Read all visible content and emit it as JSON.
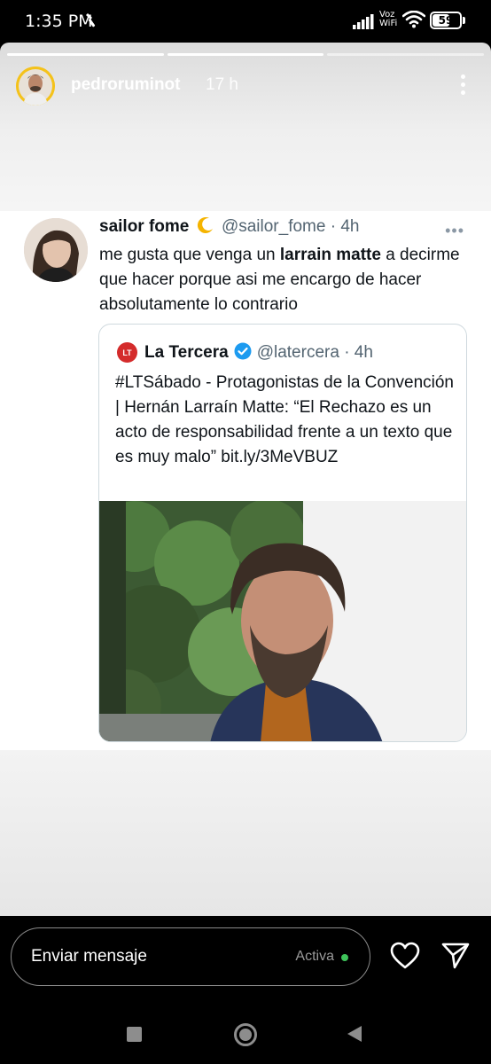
{
  "status_bar": {
    "time": "1:35 PM",
    "vowifi_line1": "Voz",
    "vowifi_line2": "WiFi",
    "battery": "59"
  },
  "story": {
    "username": "pedroruminot",
    "time_ago": "17 h",
    "progress_segments": 3,
    "progress_done": 2
  },
  "tweet": {
    "author_name": "sailor fome",
    "author_handle": "@sailor_fome · 4h",
    "text_before": "me gusta que venga un ",
    "text_bold": "larrain matte",
    "text_after": " a decirme que hacer porque asi me encargo de hacer absolutamente lo contrario",
    "more": "•••",
    "quote": {
      "logo": "LT",
      "author_name": "La Tercera",
      "author_handle": "@latercera · 4h",
      "text": "#LTSábado - Protagonistas de la Convención | Hernán Larraín Matte: “El Rechazo es un acto de responsabilidad frente a un texto que es muy malo” bit.ly/3MeVBUZ"
    }
  },
  "reply": {
    "placeholder": "Enviar mensaje",
    "status": "Activa"
  },
  "colors": {
    "accent_green": "#3ec35a",
    "verified_blue": "#1d9bf0",
    "logo_red": "#d42b2b"
  }
}
